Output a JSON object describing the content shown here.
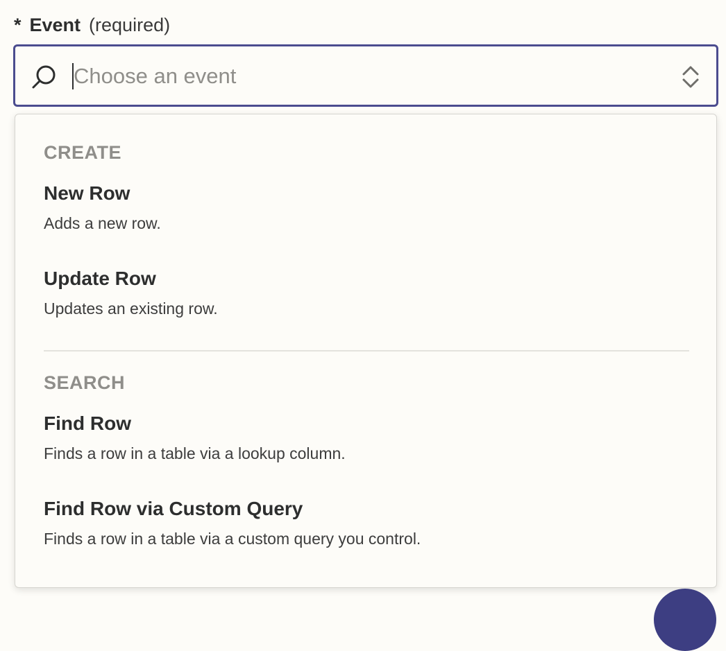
{
  "field": {
    "asterisk": "*",
    "label": "Event",
    "required_text": "(required)"
  },
  "select": {
    "placeholder": "Choose an event",
    "value": "",
    "left_icon": "search-icon",
    "right_icon": "chevron-up-down-icon"
  },
  "dropdown": {
    "groups": [
      {
        "header": "CREATE",
        "options": [
          {
            "title": "New Row",
            "description": "Adds a new row."
          },
          {
            "title": "Update Row",
            "description": "Updates an existing row."
          }
        ]
      },
      {
        "header": "SEARCH",
        "options": [
          {
            "title": "Find Row",
            "description": "Finds a row in a table via a lookup column."
          },
          {
            "title": "Find Row via Custom Query",
            "description": "Finds a row in a table via a custom query you control."
          }
        ]
      }
    ]
  },
  "colors": {
    "accent_border": "#4b4c8f",
    "fab": "#3d3e82",
    "text": "#2d2e2e",
    "muted": "#8f8e8a",
    "background": "#fdfcf8"
  }
}
